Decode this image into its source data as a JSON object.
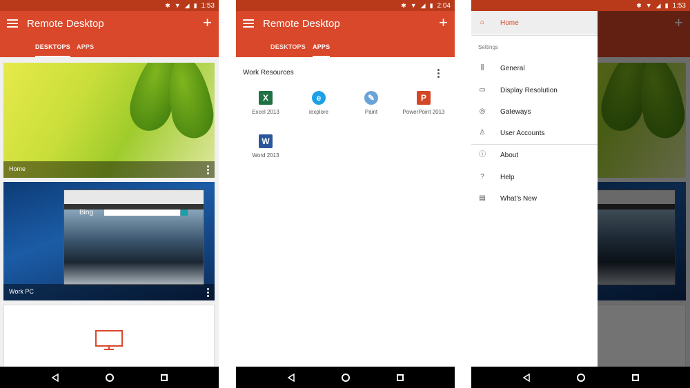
{
  "colors": {
    "accent": "#d9482b",
    "statusbar": "#b83a1a"
  },
  "screens": [
    {
      "time": "1:53",
      "app_title": "Remote Desktop",
      "tabs": [
        "DESKTOPS",
        "APPS"
      ],
      "active_tab": "DESKTOPS",
      "desktops": [
        {
          "name": "Home"
        },
        {
          "name": "Work PC"
        }
      ],
      "browser": {
        "brand": "Bing"
      }
    },
    {
      "time": "2:04",
      "app_title": "Remote Desktop",
      "tabs": [
        "DESKTOPS",
        "APPS"
      ],
      "active_tab": "APPS",
      "section": "Work Resources",
      "apps": [
        {
          "label": "Excel 2013",
          "icon": "excel-icon",
          "color": "#1f7244",
          "glyph": "X"
        },
        {
          "label": "iexplore",
          "icon": "internet-explorer-icon",
          "color": "#1ea0e6",
          "glyph": "e"
        },
        {
          "label": "Paint",
          "icon": "paint-icon",
          "color": "#6aa3d8",
          "glyph": "✎"
        },
        {
          "label": "PowerPoint 2013",
          "icon": "powerpoint-icon",
          "color": "#d24726",
          "glyph": "P"
        },
        {
          "label": "Word 2013",
          "icon": "word-icon",
          "color": "#2b579a",
          "glyph": "W"
        }
      ]
    },
    {
      "time": "1:53",
      "drawer": {
        "home": "Home",
        "settings_header": "Settings",
        "items": [
          {
            "label": "General",
            "icon": "sliders-icon"
          },
          {
            "label": "Display Resolution",
            "icon": "monitor-icon"
          },
          {
            "label": "Gateways",
            "icon": "gateway-icon"
          },
          {
            "label": "User Accounts",
            "icon": "person-icon"
          },
          {
            "label": "About",
            "icon": "info-icon"
          },
          {
            "label": "Help",
            "icon": "question-icon"
          },
          {
            "label": "What's New",
            "icon": "news-icon"
          }
        ]
      }
    }
  ]
}
